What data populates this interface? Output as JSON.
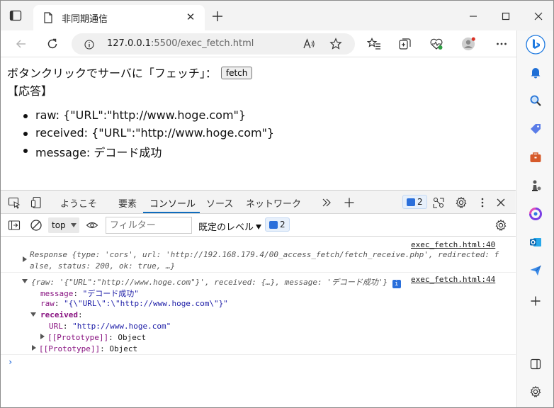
{
  "browser": {
    "tab_title": "非同期通信",
    "tab_close": "✕",
    "url_host": "127.0.0.1",
    "url_path": ":5500/exec_fetch.html"
  },
  "page": {
    "prompt_text": "ボタンクリックでサーバに「フェッチ」：",
    "fetch_button": "fetch",
    "response_heading": "【応答】",
    "results": [
      {
        "text": "raw: {\"URL\":\"http://www.hoge.com\"}"
      },
      {
        "text": "received: {\"URL\":\"http://www.hoge.com\"}"
      },
      {
        "text": "message: デコード成功"
      }
    ]
  },
  "devtools": {
    "tabs": [
      "ようこそ",
      "要素",
      "コンソール",
      "ソース",
      "ネットワーク"
    ],
    "issues_count": "2",
    "context": "top",
    "filter_placeholder": "フィルター",
    "level_label": "既定のレベル",
    "level_count": "2",
    "console": {
      "entry1_link": "exec_fetch.html:40",
      "entry1_line1": "Response {type: 'cors', url: 'http://192.168.179.4/00_access_fetch/fetch_receive.php', redirected: f",
      "entry1_line2": "alse, status: 200, ok: true, …}",
      "entry2_link": "exec_fetch.html:44",
      "entry2_summary": "{raw: '{\"URL\":\"http://www.hoge.com\"}', received: {…}, message: 'デコード成功'}",
      "message_key": "message",
      "message_val": "\"デコード成功\"",
      "raw_key": "raw",
      "raw_val": "\"{\\\"URL\\\":\\\"http://www.hoge.com\\\"}\"",
      "received_key": "received",
      "url_key": "URL",
      "url_val": "\"http://www.hoge.com\"",
      "proto_key": "[[Prototype]]",
      "proto_val": "Object"
    }
  }
}
